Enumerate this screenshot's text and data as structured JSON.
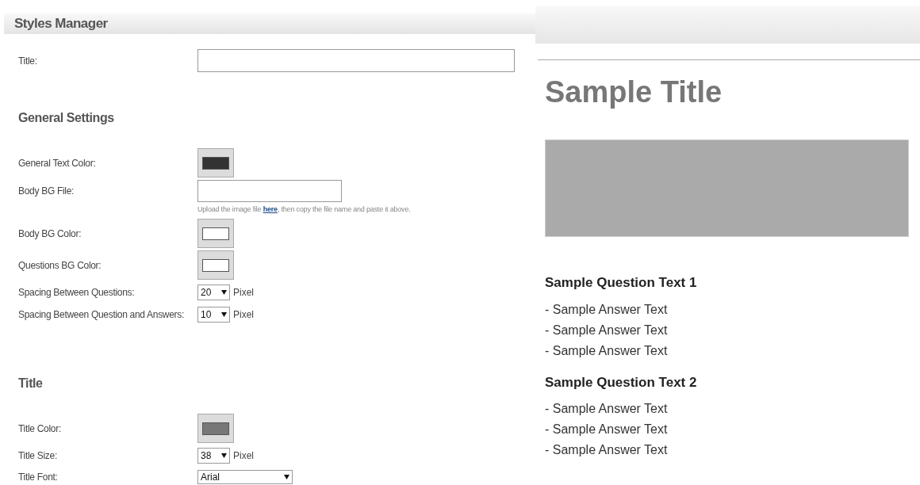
{
  "panel": {
    "title": "Styles Manager"
  },
  "title_field": {
    "label": "Title:"
  },
  "sections": [
    {
      "heading": "General Settings",
      "fields": [
        {
          "kind": "color",
          "label": "General Text Color:",
          "color": "#333333"
        },
        {
          "kind": "file",
          "label": "Body BG File:",
          "hint_before": "Upload the image file ",
          "link": "here",
          "hint_after": ", then copy the file name and paste it above."
        },
        {
          "kind": "color",
          "label": "Body BG Color:",
          "color": "#ffffff"
        },
        {
          "kind": "color",
          "label": "Questions BG Color:",
          "color": "#ffffff"
        },
        {
          "kind": "select",
          "label": "Spacing Between Questions:",
          "value": "20",
          "unit": "Pixel"
        },
        {
          "kind": "select",
          "label": "Spacing Between Question and Answers:",
          "value": "10",
          "unit": "Pixel"
        }
      ]
    },
    {
      "heading": "Title",
      "fields": [
        {
          "kind": "color",
          "label": "Title Color:",
          "color": "#777777"
        },
        {
          "kind": "select",
          "label": "Title Size:",
          "value": "38",
          "unit": "Pixel"
        },
        {
          "kind": "wide-select",
          "label": "Title Font:",
          "value": "Arial"
        }
      ]
    }
  ],
  "preview": {
    "title": "Sample Title",
    "questions": [
      {
        "text": "Sample Question Text 1",
        "answers": [
          "- Sample Answer Text",
          "- Sample Answer Text",
          "- Sample Answer Text"
        ]
      },
      {
        "text": "Sample Question Text 2",
        "answers": [
          "- Sample Answer Text",
          "- Sample Answer Text",
          "- Sample Answer Text"
        ]
      }
    ]
  }
}
